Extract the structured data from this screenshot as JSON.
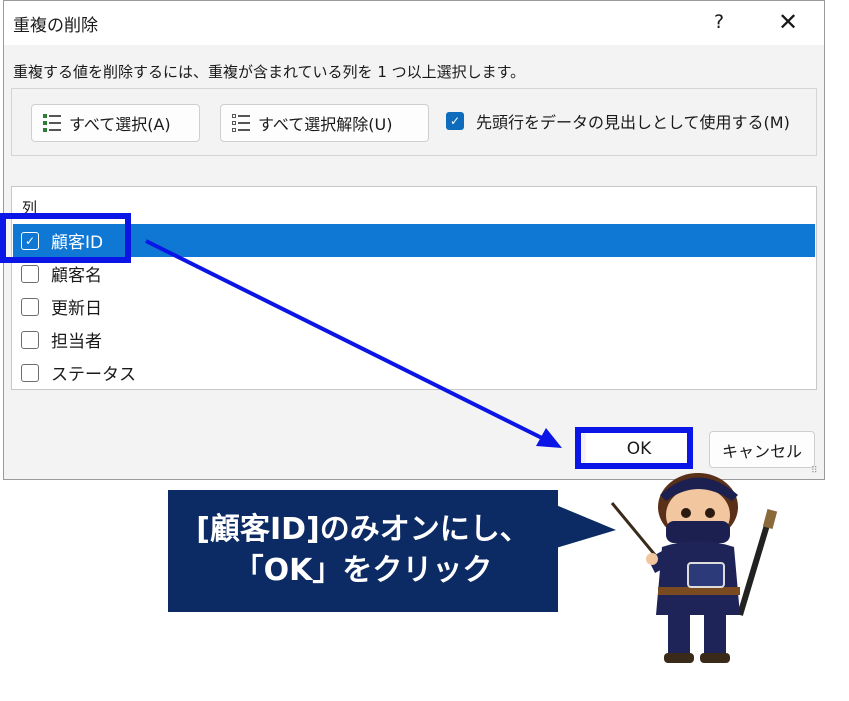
{
  "dialog": {
    "title": "重複の削除",
    "help": "?",
    "close": "✕",
    "instruction": "重複する値を削除するには、重複が含まれている列を 1 つ以上選択します。",
    "select_all_label": "すべて選択(A)",
    "unselect_all_label": "すべて選択解除(U)",
    "header_checkbox_label": "先頭行をデータの見出しとして使用する(M)",
    "header_checkbox_checked": true,
    "column_header": "列",
    "columns": [
      {
        "label": "顧客ID",
        "checked": true,
        "selected": true
      },
      {
        "label": "顧客名",
        "checked": false,
        "selected": false
      },
      {
        "label": "更新日",
        "checked": false,
        "selected": false
      },
      {
        "label": "担当者",
        "checked": false,
        "selected": false
      },
      {
        "label": "ステータス",
        "checked": false,
        "selected": false
      }
    ],
    "ok_label": "OK",
    "cancel_label": "キャンセル",
    "accent_color": "#0f78d4"
  },
  "annotation": {
    "line1": "[顧客ID]のみオンにし、",
    "line2": "「OK」をクリック",
    "highlight_color": "#0a15e6",
    "callout_color": "#0c2a63"
  }
}
